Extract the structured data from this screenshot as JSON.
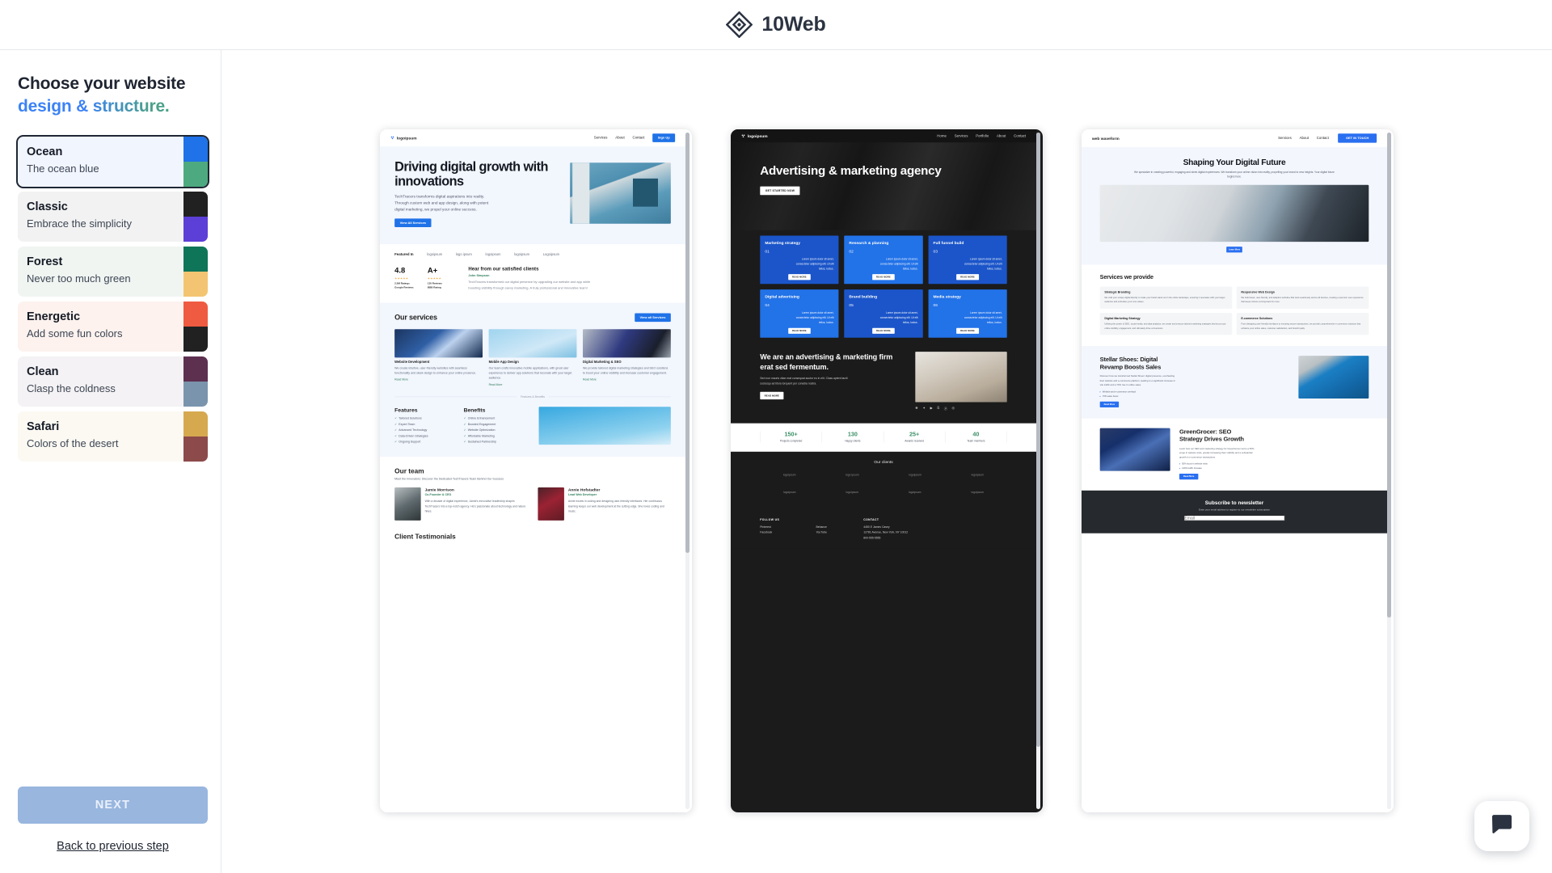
{
  "header": {
    "brand": "10Web",
    "logo_icon": "tenweb-diamond-logo"
  },
  "sidebar": {
    "title_line1": "Choose your website",
    "title_line2": "design & structure.",
    "themes": [
      {
        "name": "Ocean",
        "desc": "The ocean blue",
        "bg": "#f1f5fe",
        "selected": true,
        "swatch_top": "#1f72e8",
        "swatch_bottom": "#4da97f"
      },
      {
        "name": "Classic",
        "desc": "Embrace the simplicity",
        "bg": "#f2f2f2",
        "selected": false,
        "swatch_top": "#212121",
        "swatch_bottom": "#5c3fd6"
      },
      {
        "name": "Forest",
        "desc": "Never too much green",
        "bg": "#f0f5f2",
        "selected": false,
        "swatch_top": "#0f7558",
        "swatch_bottom": "#f3c572"
      },
      {
        "name": "Energetic",
        "desc": "Add some fun colors",
        "bg": "#fdf2ee",
        "selected": false,
        "swatch_top": "#ef5b40",
        "swatch_bottom": "#212121"
      },
      {
        "name": "Clean",
        "desc": "Clasp the coldness",
        "bg": "#f4f2f4",
        "selected": false,
        "swatch_top": "#5e3050",
        "swatch_bottom": "#7b94ad"
      },
      {
        "name": "Safari",
        "desc": "Colors of the desert",
        "bg": "#fbf9f2",
        "selected": false,
        "swatch_top": "#d6a94f",
        "swatch_bottom": "#8d4a4a"
      }
    ],
    "next_label": "NEXT",
    "back_label": "Back to previous step"
  },
  "previews": [
    {
      "id": "ocean-preview",
      "nav": {
        "logo": "logoipsum",
        "menu": [
          "Services",
          "About",
          "Contact"
        ],
        "cta": "Sign Up"
      },
      "hero": {
        "heading": "Driving digital growth with innovations",
        "paragraph": "TechTracers transforms digital aspirations into reality. Through custom web and app design, along with potent digital marketing, we propel your online success.",
        "cta": "View All Services"
      },
      "featured": {
        "label": "Featured In",
        "logos": [
          "logoipsum",
          "logo ipsum",
          "logoipsum",
          "logoipsum",
          "Logoipsum"
        ]
      },
      "stats": [
        {
          "value": "4.8",
          "stars": "★★★★★",
          "line1": "2.5M Ratings",
          "line2": "Google Reviews"
        },
        {
          "value": "A+",
          "stars": "★★★★★",
          "line1": "120 Reviews",
          "line2": "BBB Rating"
        }
      ],
      "testimonial": {
        "heading": "Hear from our satisfied clients",
        "author": "John Simpson",
        "text": "TechTracers transformed our digital presence by upgrading our website and app while boosting visibility through savvy marketing. A truly professional and innovative team!"
      },
      "services": {
        "heading": "Our services",
        "cta": "View all Services",
        "cards": [
          {
            "title": "Website Development",
            "text": "We create intuitive, user-friendly websites with seamless functionality and sleek design to enhance your online presence.",
            "link": "Read More"
          },
          {
            "title": "Mobile App Design",
            "text": "Our team crafts innovative mobile applications, with great user experience to deliver app solutions that resonate with your target audience.",
            "link": "Read More"
          },
          {
            "title": "Digital Marketing & SEO",
            "text": "We provide tailored digital marketing strategies and SEO solutions to boost your online visibility and increase customer engagement.",
            "link": "Read More"
          }
        ]
      },
      "fb_divider": "Features & Benefits",
      "features": {
        "heading": "Features",
        "items": [
          "Tailored Solutions",
          "Expert Team",
          "Advanced Technology",
          "Data-Driven Strategies",
          "Ongoing Support"
        ]
      },
      "benefits": {
        "heading": "Benefits",
        "items": [
          "Online Enhancement",
          "Boosted Engagement",
          "Website Optimization",
          "Affordable Marketing",
          "Sustained Partnership"
        ]
      },
      "team": {
        "heading": "Our team",
        "sub": "Meet the Innovators: Discover the Dedicated TechTracers Team Behind Our Success",
        "members": [
          {
            "name": "Jamie Morrison",
            "role": "Co-Founder & CEO",
            "bio": "With a decade of digital experience, Jamie's innovative leadership shapes TechTracers into a top-notch agency. He's passionate about technology and nature hikes."
          },
          {
            "name": "Annie Hofstadter",
            "role": "Lead Web Developer",
            "bio": "Annie excels in coding and designing user-friendly interfaces. Her continuous learning keeps our web development at the cutting edge. She loves coding and music."
          }
        ]
      },
      "testimonials_heading": "Client Testimonials"
    },
    {
      "id": "dark-agency-preview",
      "nav": {
        "logo": "logoipsum",
        "menu": [
          "Home",
          "Services",
          "Portfolio",
          "About",
          "Contact"
        ]
      },
      "hero": {
        "heading": "Advertising & marketing agency",
        "cta": "GET STARTED NOW"
      },
      "grid_body": "Lorem ipsum dolor sit amet, consectetur adipiscing elit. Ut elit tellus, luctus.",
      "grid_cta": "READ MORE",
      "grid": [
        {
          "title": "Marketing strategy",
          "num": "01"
        },
        {
          "title": "Research & planning",
          "num": "02"
        },
        {
          "title": "Full funnel build",
          "num": "03"
        },
        {
          "title": "Digital advertising",
          "num": "04"
        },
        {
          "title": "Brand building",
          "num": "05"
        },
        {
          "title": "Media strategy",
          "num": "06"
        }
      ],
      "about": {
        "heading": "We are an advertising & marketing firm erat sed fermentum.",
        "text": "Sed non mauris vitae erat consequat auctor eu in elit. Class aptent taciti sociosqu ad litora torquent per conubia nostra.",
        "cta": "READ MORE",
        "socials": [
          "facebook-icon",
          "twitter-icon",
          "youtube-icon",
          "behance-icon",
          "pinterest-icon",
          "instagram-icon"
        ]
      },
      "stats": [
        {
          "value": "150+",
          "label": "Projects completed"
        },
        {
          "value": "130",
          "label": "Happy clients"
        },
        {
          "value": "25+",
          "label": "Awards received"
        },
        {
          "value": "40",
          "label": "Team members"
        }
      ],
      "clients_heading": "Our clients",
      "client_logos": [
        "logoipsum",
        "logo ipsum",
        "logoipsum",
        "logoipsum",
        "logoipsum",
        "logoipsum",
        "logoipsum",
        "logoipsum"
      ],
      "footer": {
        "follow_heading": "FOLLOW US",
        "follow_links": [
          "Pinterest",
          "Behance",
          "Facebook",
          "YouTube"
        ],
        "contact_heading": "CONTACT",
        "contact_lines": [
          "4450 E James Casey",
          "12781 Avenue, New York, NY 10012",
          "800-555-5555"
        ]
      }
    },
    {
      "id": "web-waveform-preview",
      "nav": {
        "logo": "web waveform",
        "menu": [
          "Services",
          "About",
          "Contact"
        ],
        "cta": "GET IN TOUCH"
      },
      "hero": {
        "heading": "Shaping Your Digital Future",
        "paragraph": "We specialize in creating powerful, engaging and sleek digital experiences. We transform your online vision into reality, propelling your brand to new heights. Your digital future begins here.",
        "cta": "Learn More"
      },
      "services": {
        "heading": "Services we provide",
        "tiles": [
          {
            "title": "Strategic Branding",
            "text": "We craft your unique digital identity to make your brand stand out in the online landscape, ensuring it resonates with your target audience and embodies your core values."
          },
          {
            "title": "Responsive Web Design",
            "text": "We build sleek, user-friendly, and adaptive websites that work seamlessly across all devices, creating a premium user experience that keeps visitors coming back for more."
          },
          {
            "title": "Digital Marketing Strategy",
            "text": "Utilizing the power of SEO, social media, and data analytics, we create and execute tailored marketing strategies that boost your online visibility, engagement, and ultimately drive conversions."
          },
          {
            "title": "E-commerce Solutions",
            "text": "From designing user-friendly interfaces to ensuring secure transactions, we provide comprehensive e-commerce solutions that enhance your online sales, customer satisfaction, and brand loyalty."
          }
        ]
      },
      "cases": [
        {
          "title": "Stellar Shoes: Digital Revamp Boosts Sales",
          "text": "Discover how we transformed Stellar Shoes' digital presence, overhauling their website and e-commerce platform, leading to a significant increase in site traffic and a 70% rise in online sales.",
          "bullets": [
            "Website and e-commerce overhaul",
            "70% sales boost"
          ],
          "cta": "Read More"
        },
        {
          "title": "GreenGrocer: SEO Strategy Drives Growth",
          "text": "Learn how our SEO and marketing strategy for GreenGrocer led to a 50% surge in website visits, greatly increasing their visibility and a substantial growth in e-commerce transactions.",
          "bullets": [
            "50% boost in website visits",
            "120% traffic increase"
          ],
          "cta": "Read More"
        }
      ],
      "newsletter": {
        "heading": "Subscribe to newsletter",
        "sub": "Enter your email address to register to our newsletter subscription",
        "placeholder": "Email"
      }
    }
  ],
  "chat_widget": {
    "icon": "chat-bubble-icon"
  }
}
